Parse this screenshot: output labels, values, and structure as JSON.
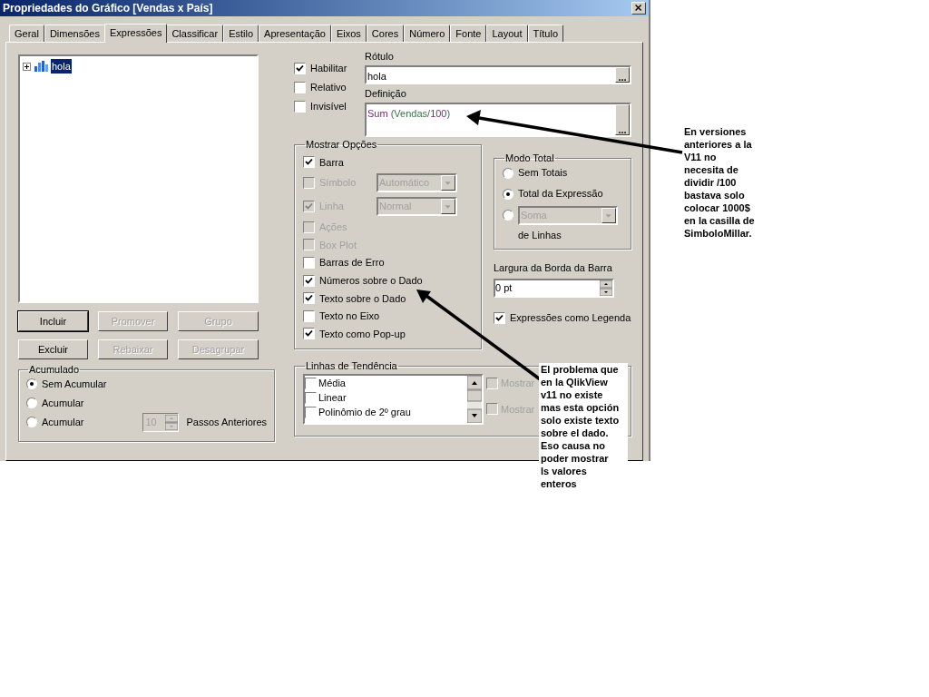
{
  "window": {
    "title": "Propriedades do Gráfico [Vendas x País]"
  },
  "tabs": [
    {
      "label": "Geral",
      "selected": false
    },
    {
      "label": "Dimensões",
      "selected": false
    },
    {
      "label": "Expressões",
      "selected": true
    },
    {
      "label": "Classificar",
      "selected": false
    },
    {
      "label": "Estilo",
      "selected": false
    },
    {
      "label": "Apresentação",
      "selected": false
    },
    {
      "label": "Eixos",
      "selected": false
    },
    {
      "label": "Cores",
      "selected": false
    },
    {
      "label": "Número",
      "selected": false
    },
    {
      "label": "Fonte",
      "selected": false
    },
    {
      "label": "Layout",
      "selected": false
    },
    {
      "label": "Título",
      "selected": false
    }
  ],
  "expression_tree": [
    {
      "label": "hola",
      "selected": true,
      "expanded": false
    }
  ],
  "buttons": [
    {
      "label": "Incluir",
      "disabled": false,
      "default": true
    },
    {
      "label": "Promover",
      "disabled": true,
      "default": false
    },
    {
      "label": "Grupo",
      "disabled": true,
      "default": false
    },
    {
      "label": "Excluir",
      "disabled": false,
      "default": false
    },
    {
      "label": "Rebaixar",
      "disabled": true,
      "default": false
    },
    {
      "label": "Desagrupar",
      "disabled": true,
      "default": false
    }
  ],
  "accumulation": {
    "title": "Acumulado",
    "options": [
      {
        "label": "Sem Acumular",
        "selected": true
      },
      {
        "label": "Acumular",
        "selected": false
      },
      {
        "label": "Acumular",
        "selected": false
      }
    ],
    "steps": {
      "value": "10",
      "disabled": true,
      "label": "Passos Anteriores"
    }
  },
  "expression_flags": [
    {
      "label": "Habilitar",
      "checked": true
    },
    {
      "label": "Relativo",
      "checked": false
    },
    {
      "label": "Invisível",
      "checked": false
    }
  ],
  "label_field": {
    "label": "Rótulo",
    "value": "hola",
    "button": "..."
  },
  "definition": {
    "label": "Definição",
    "value": "Sum (Vendas/100)",
    "button": "..."
  },
  "display_options": {
    "title": "Mostrar Opções",
    "items": [
      {
        "kind": "checkbox",
        "label": "Barra",
        "checked": true,
        "disabled": false
      },
      {
        "kind": "dropdown",
        "label": "Símbolo",
        "checked": false,
        "disabled": true,
        "value": "Automático"
      },
      {
        "kind": "dropdown",
        "label": "Linha",
        "checked": true,
        "disabled": true,
        "value": "Normal"
      },
      {
        "kind": "checkbox",
        "label": "Ações",
        "checked": false,
        "disabled": true
      },
      {
        "kind": "checkbox",
        "label": "Box Plot",
        "checked": false,
        "disabled": true
      },
      {
        "kind": "checkbox",
        "label": "Barras de Erro",
        "checked": false,
        "disabled": false
      },
      {
        "kind": "checkbox",
        "label": "Números sobre o Dado",
        "checked": true,
        "disabled": false
      },
      {
        "kind": "checkbox",
        "label": "Texto sobre o Dado",
        "checked": true,
        "disabled": false
      },
      {
        "kind": "checkbox",
        "label": "Texto no Eixo",
        "checked": false,
        "disabled": false
      },
      {
        "kind": "checkbox",
        "label": "Texto como Pop-up",
        "checked": true,
        "disabled": false
      }
    ]
  },
  "total_mode": {
    "title": "Modo Total",
    "options": [
      {
        "label": "Sem Totais",
        "selected": false
      },
      {
        "label": "Total da Expressão",
        "selected": true
      },
      {
        "label": "de Linhas",
        "selected": false,
        "dropdown": "Soma"
      }
    ]
  },
  "bar_border_width": {
    "label": "Largura da Borda da Barra",
    "value": "0 pt"
  },
  "legend_option": {
    "label": "Expressões como Legenda",
    "checked": true
  },
  "trend_lines": {
    "title": "Linhas de Tendência",
    "items": [
      {
        "label": "Média",
        "checked": false
      },
      {
        "label": "Linear",
        "checked": false
      },
      {
        "label": "Polinômio de 2º grau",
        "checked": false
      }
    ],
    "show_options": [
      {
        "label": "Mostrar",
        "checked": false,
        "disabled": true
      },
      {
        "label": "Mostrar",
        "checked": false,
        "disabled": true
      }
    ]
  },
  "annotations": [
    {
      "text": "En versiones\nanteriores a la\nV11 no\nnecesita de\ndividir /100\nbastava solo\ncolocar 1000$\nen la casilla de\nSimboloMillar."
    },
    {
      "text": "El problema que\nen la QlikView\nv11 no existe\nmas esta opción\nsolo existe texto\nsobre el dado.\nEso causa no\npoder mostrar\nls valores\nenteros"
    }
  ]
}
